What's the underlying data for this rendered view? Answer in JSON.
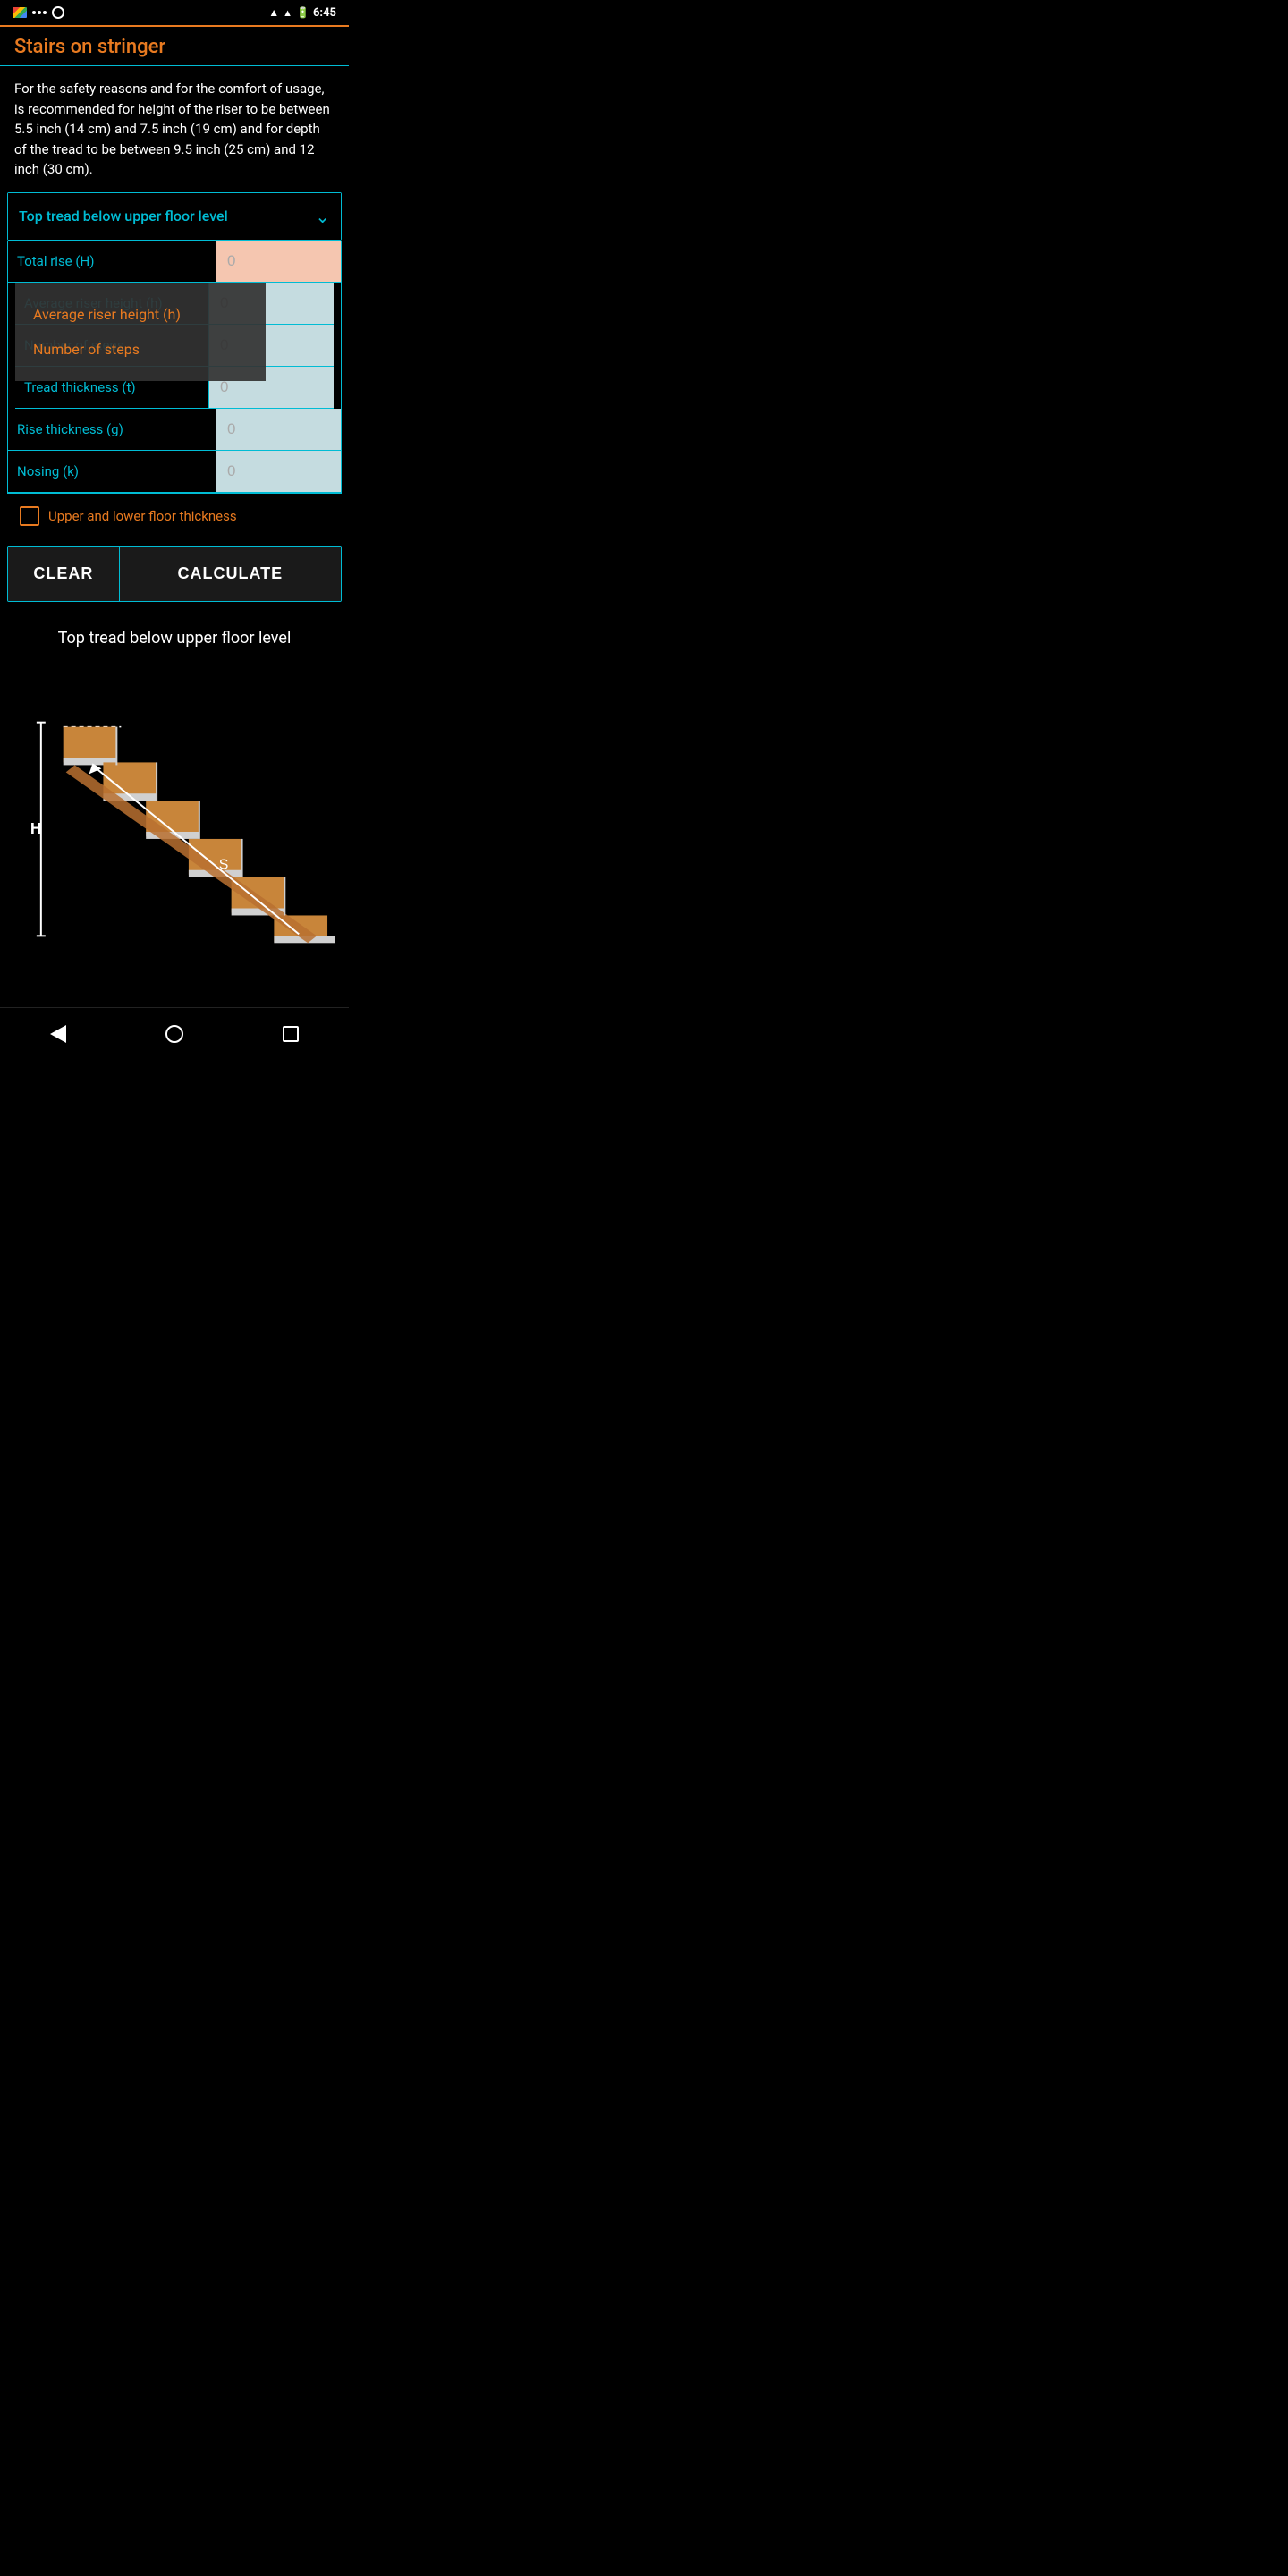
{
  "statusBar": {
    "time": "6:45",
    "icons": [
      "gmail",
      "dots",
      "circle",
      "wifi",
      "signal",
      "battery"
    ]
  },
  "app": {
    "title": "Stairs on stringer",
    "description": "For the safety reasons and for the comfort of usage, is recommended for height of the riser to be between 5.5 inch (14 cm) and 7.5 inch (19 cm) and for depth of the tread to be between 9.5 inch (25 cm) and 12 inch (30 cm).",
    "dropdown": {
      "label": "Top tread below upper floor level"
    },
    "fields": [
      {
        "label": "Total rise (H)",
        "value": "0",
        "inputType": "pink"
      },
      {
        "label": "Average riser height (h)",
        "value": "0",
        "inputType": "blue-light"
      },
      {
        "label": "Number of steps",
        "value": "0",
        "inputType": "blue-light"
      },
      {
        "label": "Tread thickness (t)",
        "value": "0",
        "inputType": "blue-light"
      },
      {
        "label": "Rise thickness (g)",
        "value": "0",
        "inputType": "blue-light"
      },
      {
        "label": "Nosing (k)",
        "value": "0",
        "inputType": "blue-light"
      }
    ],
    "overlayItems": [
      "Average riser height (h)",
      "Number of steps"
    ],
    "checkbox": {
      "label": "Upper and lower floor thickness",
      "checked": false
    },
    "buttons": {
      "clear": "CLEAR",
      "calculate": "CALCULATE"
    },
    "diagram": {
      "title": "Top tread below upper floor level",
      "labels": {
        "h": "H",
        "s": "S"
      }
    }
  }
}
